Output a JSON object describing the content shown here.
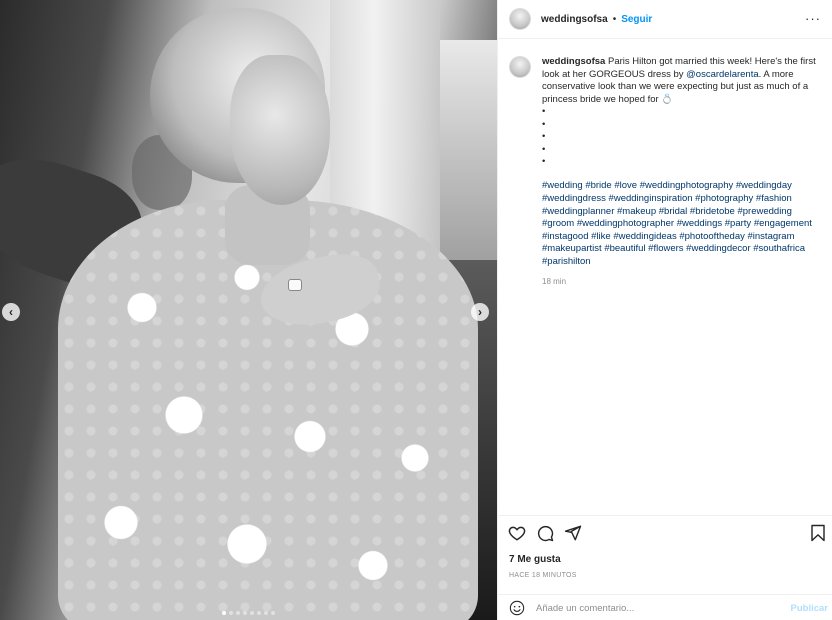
{
  "media": {
    "image_description_icon": "photo",
    "carousel": {
      "dot_count": 8,
      "active_index": 0
    },
    "prev_icon": "chevron-left-icon",
    "next_icon": "chevron-right-icon",
    "prev_glyph": "‹",
    "next_glyph": "›"
  },
  "header": {
    "username": "weddingsofsa",
    "separator": "•",
    "follow_label": "Seguir",
    "more_glyph": "···"
  },
  "caption": {
    "username": "weddingsofsa",
    "text_before_mention": "Paris Hilton got married this week! Here's the first look at her GORGEOUS dress by",
    "mention": "@oscardelarenta",
    "text_after_mention": ". A more conservative look than we were expecting but just as much of a princess bride we hoped for",
    "emoji": "💍",
    "bullets": [
      "•",
      "•",
      "•",
      "•",
      "•"
    ],
    "hashtags": [
      "#wedding",
      "#bride",
      "#love",
      "#weddingphotography",
      "#weddingday",
      "#weddingdress",
      "#weddinginspiration",
      "#photography",
      "#fashion",
      "#weddingplanner",
      "#makeup",
      "#bridal",
      "#bridetobe",
      "#prewedding",
      "#groom",
      "#weddingphotographer",
      "#weddings",
      "#party",
      "#engagement",
      "#instagood",
      "#like",
      "#weddingideas",
      "#photooftheday",
      "#instagram",
      "#makeupartist",
      "#beautiful",
      "#flowers",
      "#weddingdecor",
      "#southafrica",
      "#parishilton"
    ],
    "time": "18 min"
  },
  "actions": {
    "likes": "7 Me gusta",
    "ago": "HACE 18 MINUTOS"
  },
  "comment_box": {
    "placeholder": "Añade un comentario...",
    "post_label": "Publicar"
  },
  "colors": {
    "accent": "#0095f6",
    "link": "#00376b",
    "muted": "#8e8e8e",
    "post_disabled": "#b2dffc"
  }
}
